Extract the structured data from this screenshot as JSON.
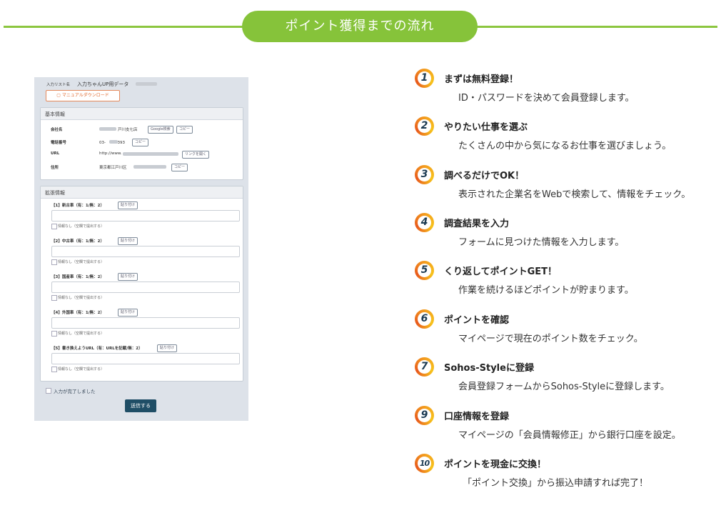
{
  "header": {
    "title": "ポイント獲得までの流れ"
  },
  "form": {
    "list_name_label": "入力リスト名",
    "list_name_value": "入力ちゃんUP用データ",
    "manual_download": "マニュアルダウンロード",
    "basic_info": {
      "title": "基本情報",
      "rows": [
        {
          "label": "会社名",
          "value": "戸川支七店",
          "buttons": [
            "Google検索",
            "コピー"
          ]
        },
        {
          "label": "電話番号",
          "value": "03-　　-0393",
          "buttons": [
            "コピー"
          ]
        },
        {
          "label": "URL",
          "value": "http://www.",
          "buttons": [
            "リンクを開く"
          ]
        },
        {
          "label": "住所",
          "value": "東京都江戸川区",
          "buttons": [
            "コピー"
          ]
        }
      ]
    },
    "ext_info": {
      "title": "拡張情報",
      "paste_label": "貼り付け",
      "none_label": "情報なし（空欄で提出する）",
      "fields": [
        "【1】新古車（有：1/無：2）",
        "【2】中古車（有：1/無：2）",
        "【3】国産車（有：1/無：2）",
        "【4】外国車（有：1/無：2）",
        "【5】書き換えようURL（有：URLを記載/無：2）"
      ]
    },
    "complete_label": "入力が完了しました",
    "submit_label": "送信する"
  },
  "steps": [
    {
      "num": "1",
      "title": "まずは無料登録！",
      "desc": "ID・パスワードを決めて会員登録します。"
    },
    {
      "num": "2",
      "title": "やりたい仕事を選ぶ",
      "desc": "たくさんの中から気になるお仕事を選びましょう。"
    },
    {
      "num": "3",
      "title": "調べるだけでOK！",
      "desc": "表示された企業名をWebで検索して、情報をチェック。"
    },
    {
      "num": "4",
      "title": "調査結果を入力",
      "desc": "フォームに見つけた情報を入力します。"
    },
    {
      "num": "5",
      "title": "くり返してポイントGET！",
      "desc": "作業を続けるほどポイントが貯まります。"
    },
    {
      "num": "6",
      "title": "ポイントを確認",
      "desc": "マイページで現在のポイント数をチェック。"
    },
    {
      "num": "7",
      "title": "Sohos-Styleに登録",
      "desc": "会員登録フォームからSohos-Styleに登録します。"
    },
    {
      "num": "9",
      "title": "口座情報を登録",
      "desc": "マイページの「会員情報修正」から銀行口座を設定。"
    },
    {
      "num": "10",
      "title": "ポイントを現金に交換！",
      "desc": "「ポイント交換」から振込申請すれば完了！"
    }
  ],
  "colors": {
    "accent_green": "#86c33a",
    "badge_orange": "#f39c1e",
    "submit_navy": "#1f4e66"
  }
}
